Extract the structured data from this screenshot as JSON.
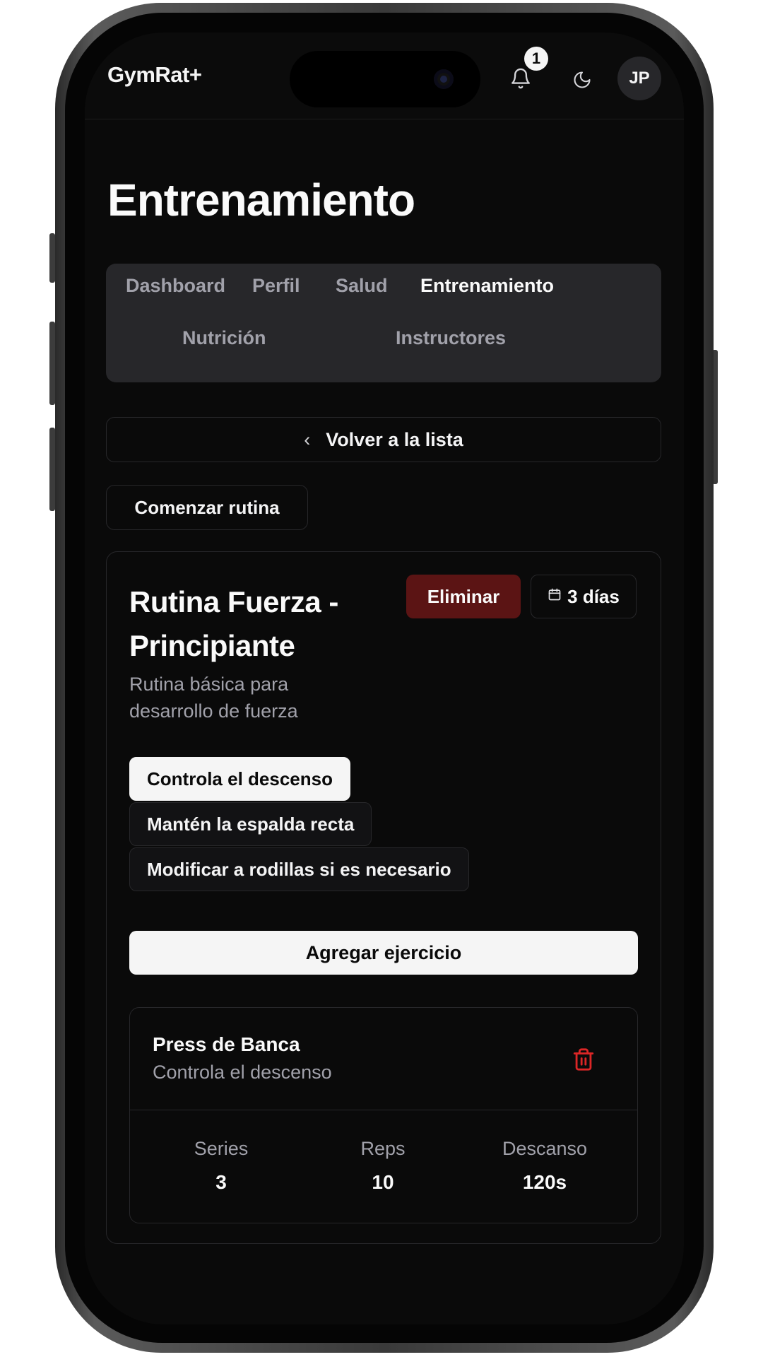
{
  "header": {
    "brand": "GymRat+",
    "notifications_count": "1",
    "avatar_initials": "JP",
    "icons": [
      "bell-icon",
      "moon-icon"
    ]
  },
  "page": {
    "title": "Entrenamiento"
  },
  "tabs": [
    {
      "label": "Dashboard",
      "active": false
    },
    {
      "label": "Perfil",
      "active": false
    },
    {
      "label": "Salud",
      "active": false
    },
    {
      "label": "Entrenamiento",
      "active": true
    },
    {
      "label": "Nutrición",
      "active": false
    },
    {
      "label": "Instructores",
      "active": false
    }
  ],
  "actions": {
    "back_label": "Volver a la lista",
    "start_label": "Comenzar rutina"
  },
  "routine": {
    "title": "Rutina Fuerza - Principiante",
    "description": "Rutina básica para desarrollo de fuerza",
    "delete_label": "Eliminar",
    "days_label": "3 días",
    "tips": [
      "Controla el descenso",
      "Mantén la espalda recta",
      "Modificar a rodillas si es necesario"
    ],
    "add_exercise_label": "Agregar ejercicio",
    "exercises": [
      {
        "name": "Press de Banca",
        "note": "Controla el descenso",
        "stats": [
          {
            "label": "Series",
            "value": "3"
          },
          {
            "label": "Reps",
            "value": "10"
          },
          {
            "label": "Descanso",
            "value": "120s"
          }
        ]
      }
    ]
  },
  "colors": {
    "background": "#0a0a0a",
    "tabs_bg": "#27272a",
    "destructive": "#5b1414",
    "trash_icon": "#dc2626",
    "primary_button": "#f5f5f5"
  }
}
